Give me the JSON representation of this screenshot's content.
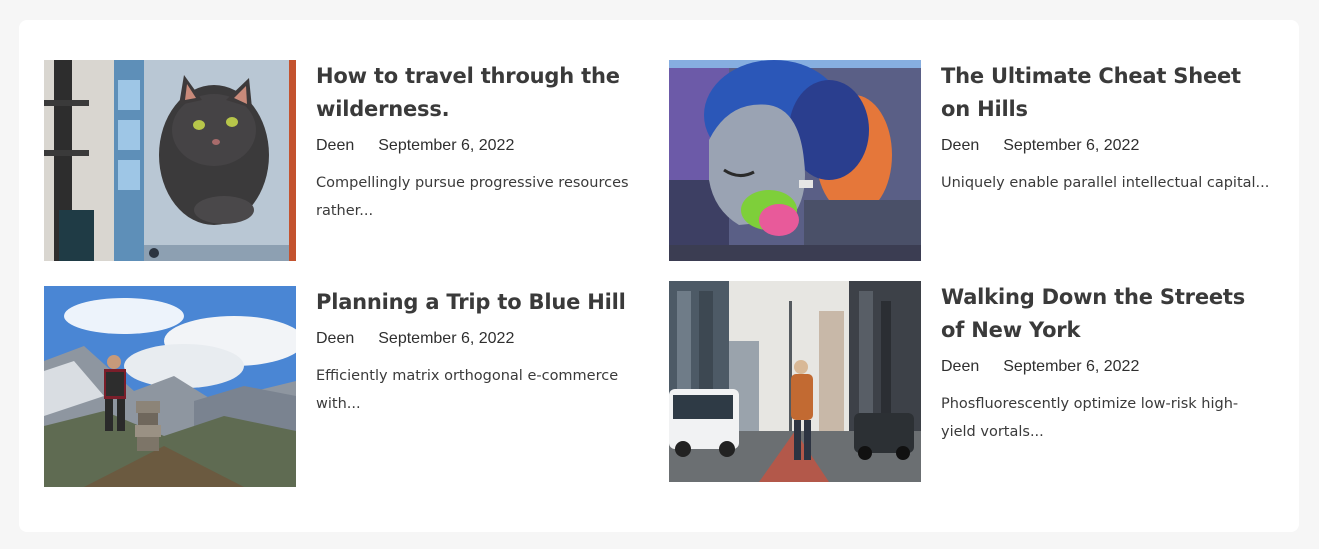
{
  "posts": [
    {
      "title": "How to travel through the wilderness.",
      "author": "Deen",
      "date": "September 6, 2022",
      "excerpt": "Compellingly pursue progressive resources rather...",
      "image": "cat-mural-photo"
    },
    {
      "title": "The Ultimate Cheat Sheet on Hills",
      "author": "Deen",
      "date": "September 6, 2022",
      "excerpt": "Uniquely enable parallel intellectual capital...",
      "image": "woman-graffiti-photo"
    },
    {
      "title": "Planning a Trip to Blue Hill",
      "author": "Deen",
      "date": "September 6, 2022",
      "excerpt": "Efficiently matrix orthogonal e-commerce with...",
      "image": "mountain-hiker-photo"
    },
    {
      "title": "Walking Down the Streets of New York",
      "author": "Deen",
      "date": "September 6, 2022",
      "excerpt": "Phosfluorescently optimize low-risk high-yield vortals...",
      "image": "city-street-photo"
    }
  ],
  "colors": {
    "page_bg": "#f6f6f6",
    "card_bg": "#ffffff",
    "title": "#3a3a3a",
    "text": "#2f2f2f"
  }
}
